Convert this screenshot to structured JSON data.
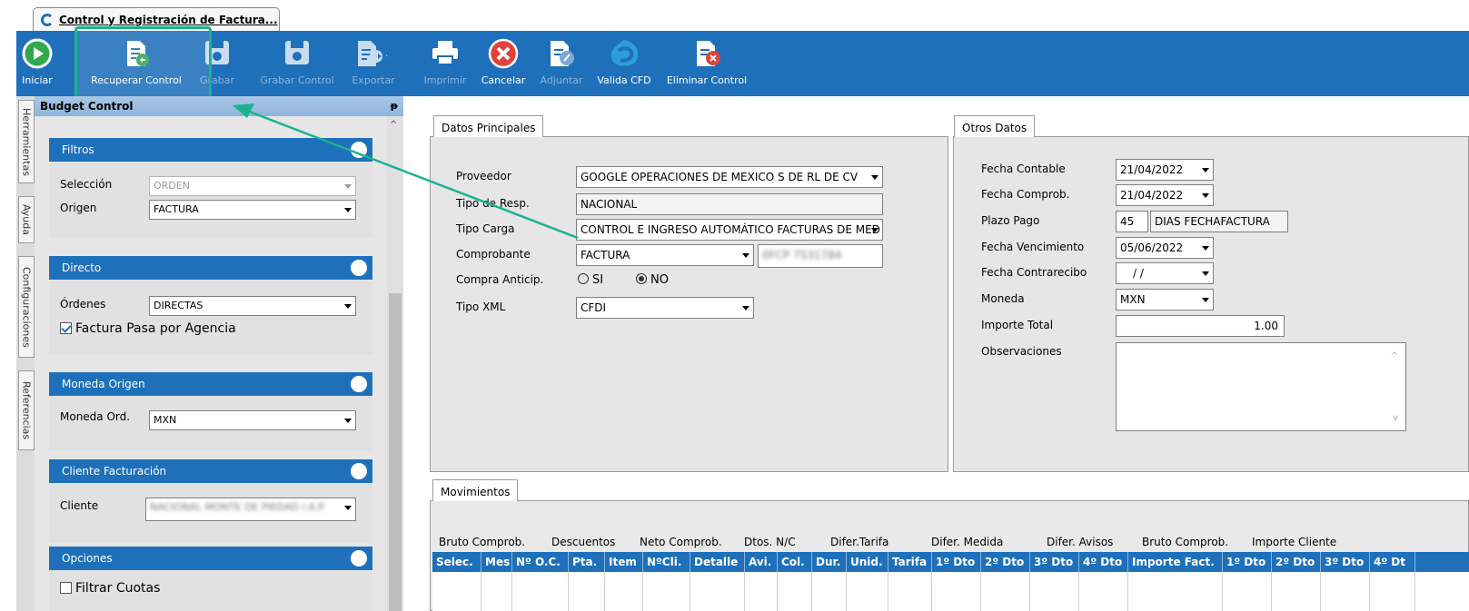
{
  "window": {
    "tab_title": "Control y Registración de Factura..."
  },
  "toolbar": {
    "iniciar": "Iniciar",
    "recuperar": "Recuperar Control",
    "grabar": "Grabar",
    "grabar_control": "Grabar Control",
    "exportar": "Exportar",
    "imprimir": "Imprimir",
    "cancelar": "Cancelar",
    "adjuntar": "Adjuntar",
    "valida_cfd": "Valida CFD",
    "eliminar": "Eliminar Control"
  },
  "side_tabs": [
    "Herramientas",
    "Ayuda",
    "Configuraciones",
    "Referencias"
  ],
  "budget": {
    "title": "Budget Control",
    "pin": "ᵽ",
    "filtros": {
      "title": "Filtros",
      "seleccion_label": "Selección",
      "seleccion_value": "ORDEN",
      "origen_label": "Origen",
      "origen_value": "FACTURA"
    },
    "directo": {
      "title": "Directo",
      "ordenes_label": "Órdenes",
      "ordenes_value": "DIRECTAS",
      "agencia_label": "Factura Pasa por Agencia"
    },
    "moneda": {
      "title": "Moneda Origen",
      "label": "Moneda Ord.",
      "value": "MXN"
    },
    "cliente": {
      "title": "Cliente Facturación",
      "label": "Cliente",
      "value": "NACIONAL MONTE DE PIEDAD I.A.P."
    },
    "opciones": {
      "title": "Opciones",
      "filtrar_label": "Filtrar Cuotas"
    }
  },
  "principales": {
    "tab": "Datos Principales",
    "proveedor_label": "Proveedor",
    "proveedor_value": "GOOGLE OPERACIONES DE MEXICO S DE RL DE CV",
    "tipo_resp_label": "Tipo de Resp.",
    "tipo_resp_value": "NACIONAL",
    "tipo_carga_label": "Tipo Carga",
    "tipo_carga_value": "CONTROL E INGRESO AUTOMÁTICO FACTURAS DE MED",
    "comprobante_label": "Comprobante",
    "comprobante_value": "FACTURA",
    "comprobante_num": "0FCP 7531784",
    "anticip_label": "Compra Anticip.",
    "si": "SI",
    "no": "NO",
    "tipo_xml_label": "Tipo XML",
    "tipo_xml_value": "CFDI"
  },
  "otros": {
    "tab": "Otros Datos",
    "fecha_contable_label": "Fecha Contable",
    "fecha_contable_value": "21/04/2022",
    "fecha_comprob_label": "Fecha Comprob.",
    "fecha_comprob_value": "21/04/2022",
    "plazo_label": "Plazo Pago",
    "plazo_value": "45",
    "plazo_desc": "DIAS FECHAFACTURA",
    "vencimiento_label": "Fecha Vencimiento",
    "vencimiento_value": "05/06/2022",
    "contrarecibo_label": "Fecha Contrarecibo",
    "contrarecibo_value": "/ /",
    "moneda_label": "Moneda",
    "moneda_value": "MXN",
    "importe_label": "Importe Total",
    "importe_value": "1.00",
    "observaciones_label": "Observaciones"
  },
  "movimientos": {
    "tab": "Movimientos",
    "summary_cols": [
      "Bruto Comprob.",
      "Descuentos",
      "Neto Comprob.",
      "Dtos. N/C",
      "Difer.Tarifa",
      "Difer. Medida",
      "Difer. Avisos",
      "Bruto Comprob.",
      "Importe Cliente"
    ],
    "grid_cols": [
      "Selec.",
      "Mes",
      "Nº O.C.",
      "Pta.",
      "Item",
      "NºCli.",
      "Detalle",
      "Avi.",
      "Col.",
      "Dur.",
      "Unid.",
      "Tarifa",
      "1º Dto",
      "2º Dto",
      "3º Dto",
      "4º Dto",
      "Importe Fact.",
      "1º Dto",
      "2º Dto",
      "3º Dto",
      "4º Dt"
    ]
  },
  "colors": {
    "ribbon": "#1e70bb",
    "highlight": "#1bb28f"
  }
}
